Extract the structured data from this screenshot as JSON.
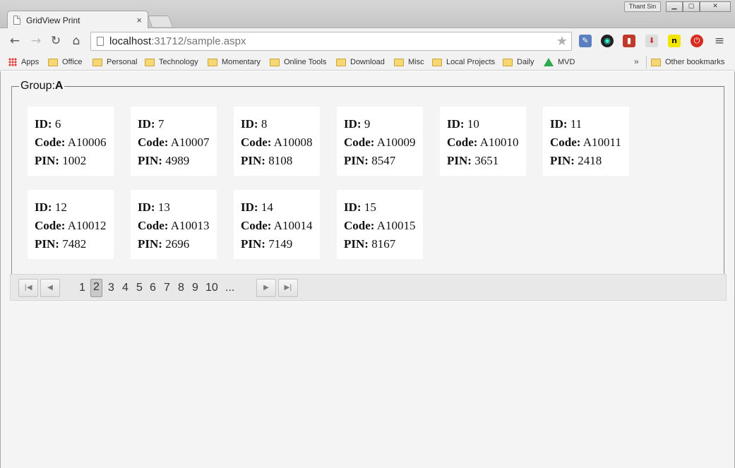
{
  "browser": {
    "tab_title": "GridView Print",
    "tab_close": "×",
    "user": "Thant Sin",
    "window_min": "▁",
    "window_max": "▢",
    "window_close": "✕",
    "url_host": "localhost",
    "url_path": ":31712/sample.aspx",
    "star": "★",
    "back": "←",
    "forward": "→",
    "reload": "↻",
    "home": "⌂",
    "menu": "≡",
    "bookmarks": [
      {
        "label": "Apps",
        "icon": "apps-icon"
      },
      {
        "label": "Office",
        "icon": "folder-icon"
      },
      {
        "label": "Personal",
        "icon": "folder-icon"
      },
      {
        "label": "Technology",
        "icon": "folder-icon"
      },
      {
        "label": "Momentary",
        "icon": "folder-icon"
      },
      {
        "label": "Online Tools",
        "icon": "folder-icon"
      },
      {
        "label": "Download",
        "icon": "folder-icon"
      },
      {
        "label": "Misc",
        "icon": "folder-icon"
      },
      {
        "label": "Local Projects",
        "icon": "folder-icon"
      },
      {
        "label": "Daily",
        "icon": "folder-icon"
      },
      {
        "label": "MVD",
        "icon": "drive-icon"
      }
    ],
    "bookmarks_more": "»",
    "other_bookmarks": "Other bookmarks"
  },
  "group": {
    "legend_prefix": "Group:",
    "legend_value": "A"
  },
  "labels": {
    "id": "ID:",
    "code": "Code:",
    "pin": "PIN:"
  },
  "records": [
    {
      "id": "6",
      "code": "A10006",
      "pin": "1002"
    },
    {
      "id": "7",
      "code": "A10007",
      "pin": "4989"
    },
    {
      "id": "8",
      "code": "A10008",
      "pin": "8108"
    },
    {
      "id": "9",
      "code": "A10009",
      "pin": "8547"
    },
    {
      "id": "10",
      "code": "A10010",
      "pin": "3651"
    },
    {
      "id": "11",
      "code": "A10011",
      "pin": "2418"
    },
    {
      "id": "12",
      "code": "A10012",
      "pin": "7482"
    },
    {
      "id": "13",
      "code": "A10013",
      "pin": "2696"
    },
    {
      "id": "14",
      "code": "A10014",
      "pin": "7149"
    },
    {
      "id": "15",
      "code": "A10015",
      "pin": "8167"
    }
  ],
  "pager": {
    "first": "|◀",
    "prev": "◀",
    "next": "▶",
    "last": "▶|",
    "pages": [
      "1",
      "2",
      "3",
      "4",
      "5",
      "6",
      "7",
      "8",
      "9",
      "10",
      "..."
    ],
    "current_page": "2"
  }
}
